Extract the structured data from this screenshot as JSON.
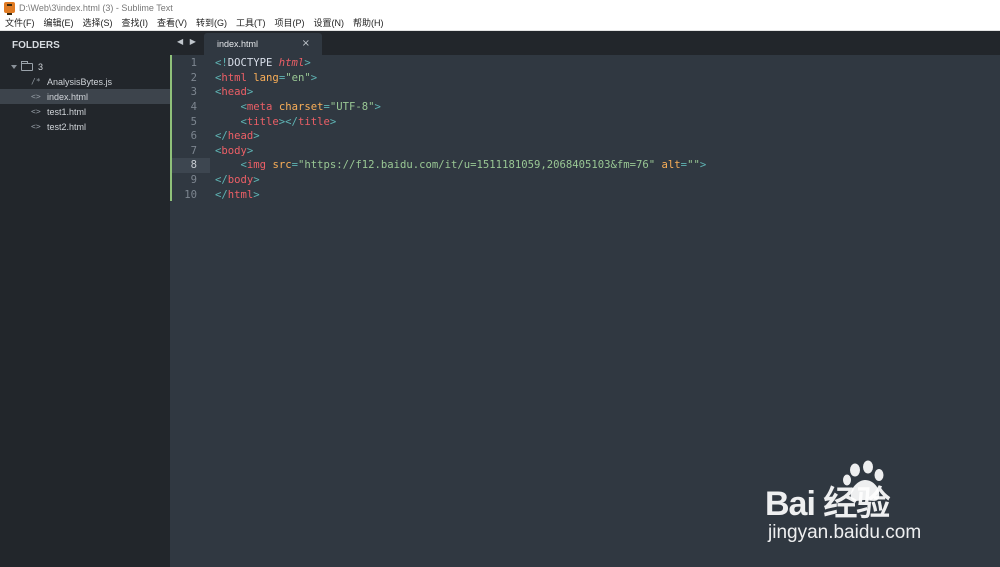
{
  "window": {
    "title": "D:\\Web\\3\\index.html (3) - Sublime Text"
  },
  "menu": [
    "文件(F)",
    "编辑(E)",
    "选择(S)",
    "查找(I)",
    "查看(V)",
    "转到(G)",
    "工具(T)",
    "项目(P)",
    "设置(N)",
    "帮助(H)"
  ],
  "sidebar": {
    "header": "FOLDERS",
    "folder": "3",
    "files": [
      {
        "glyph": "/*",
        "name": "AnalysisBytes.js"
      },
      {
        "glyph": "<>",
        "name": "index.html"
      },
      {
        "glyph": "<>",
        "name": "test1.html"
      },
      {
        "glyph": "<>",
        "name": "test2.html"
      }
    ]
  },
  "tabs": {
    "nav": "◀ ▶",
    "active": "index.html",
    "close": "×"
  },
  "editor": {
    "current_line": 8,
    "lines": [
      {
        "n": "1",
        "parts": [
          [
            "p",
            "<!"
          ],
          [
            "d",
            "DOCTYPE "
          ],
          [
            "k",
            "html"
          ],
          [
            "p",
            ">"
          ]
        ]
      },
      {
        "n": "2",
        "parts": [
          [
            "p",
            "<"
          ],
          [
            "t",
            "html"
          ],
          [
            "d",
            " "
          ],
          [
            "a",
            "lang"
          ],
          [
            "p",
            "="
          ],
          [
            "s",
            "\"en\""
          ],
          [
            "p",
            ">"
          ]
        ]
      },
      {
        "n": "3",
        "parts": [
          [
            "p",
            "<"
          ],
          [
            "t",
            "head"
          ],
          [
            "p",
            ">"
          ]
        ]
      },
      {
        "n": "4",
        "parts": [
          [
            "d",
            "    "
          ],
          [
            "p",
            "<"
          ],
          [
            "t",
            "meta"
          ],
          [
            "d",
            " "
          ],
          [
            "a",
            "charset"
          ],
          [
            "p",
            "="
          ],
          [
            "s",
            "\"UTF-8\""
          ],
          [
            "p",
            ">"
          ]
        ]
      },
      {
        "n": "5",
        "parts": [
          [
            "d",
            "    "
          ],
          [
            "p",
            "<"
          ],
          [
            "t",
            "title"
          ],
          [
            "p",
            "></"
          ],
          [
            "t",
            "title"
          ],
          [
            "p",
            ">"
          ]
        ]
      },
      {
        "n": "6",
        "parts": [
          [
            "p",
            "</"
          ],
          [
            "t",
            "head"
          ],
          [
            "p",
            ">"
          ]
        ]
      },
      {
        "n": "7",
        "parts": [
          [
            "p",
            "<"
          ],
          [
            "t",
            "body"
          ],
          [
            "p",
            ">"
          ]
        ]
      },
      {
        "n": "8",
        "parts": [
          [
            "d",
            "    "
          ],
          [
            "p",
            "<"
          ],
          [
            "t",
            "img"
          ],
          [
            "d",
            " "
          ],
          [
            "a",
            "src"
          ],
          [
            "p",
            "="
          ],
          [
            "s",
            "\"https://f12.baidu.com/it/u=1511181059,2068405103&fm=76\""
          ],
          [
            "d",
            " "
          ],
          [
            "a",
            "alt"
          ],
          [
            "p",
            "="
          ],
          [
            "s",
            "\"\""
          ],
          [
            "p",
            ">"
          ]
        ]
      },
      {
        "n": "9",
        "parts": [
          [
            "p",
            "</"
          ],
          [
            "t",
            "body"
          ],
          [
            "p",
            ">"
          ]
        ]
      },
      {
        "n": "10",
        "parts": [
          [
            "p",
            "</"
          ],
          [
            "t",
            "html"
          ],
          [
            "p",
            ">"
          ]
        ]
      }
    ]
  },
  "watermark": {
    "logo": "Bai 经验",
    "url": "jingyan.baidu.com"
  },
  "colors": {
    "sidebar_bg": "#22262b",
    "editor_bg": "#303841",
    "tag": "#ec5f66",
    "attribute": "#f9ae58",
    "string": "#99c794",
    "punctuation": "#5fb4b4",
    "modified_marker": "#8fc17a"
  }
}
